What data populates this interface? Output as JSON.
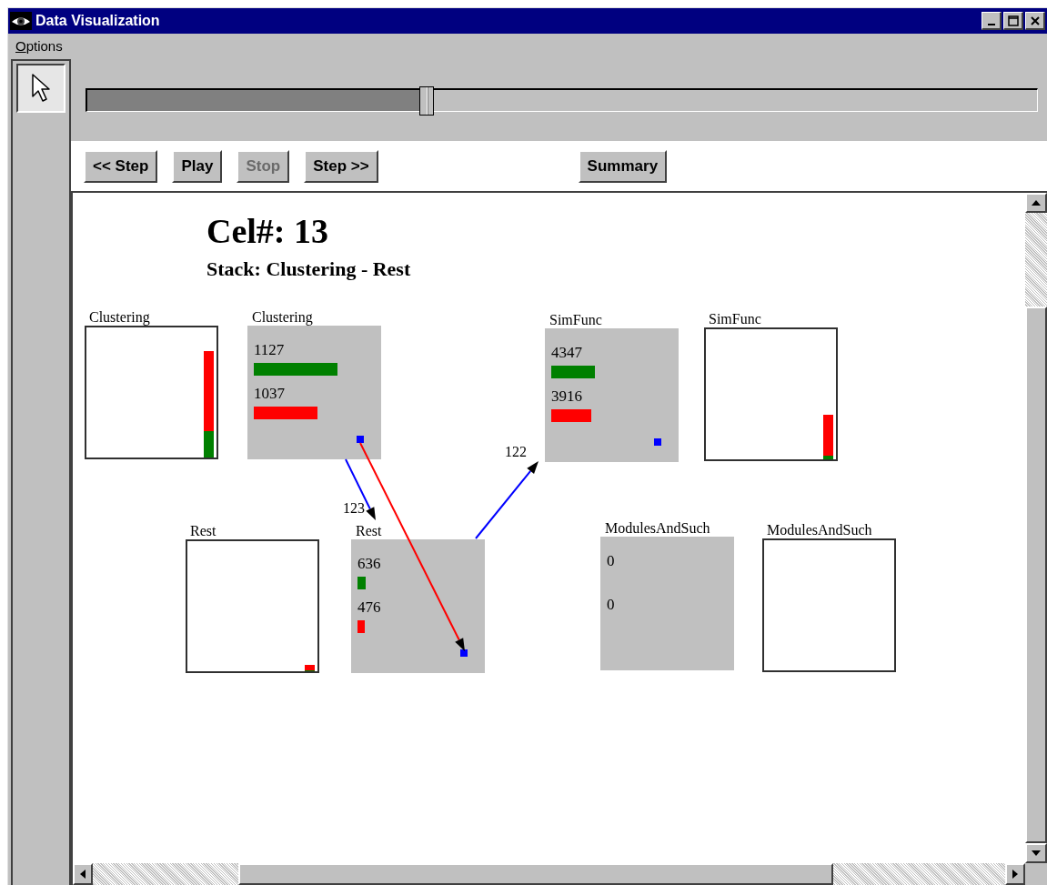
{
  "window": {
    "title": "Data Visualization"
  },
  "menu": [
    {
      "label": "Options"
    }
  ],
  "pointer_tool": {
    "selected": true
  },
  "timeline": {
    "level": 0.352
  },
  "controls": [
    {
      "label": "<< Step",
      "disabled": false
    },
    {
      "label": "Play",
      "disabled": false
    },
    {
      "label": "Stop",
      "disabled": true
    },
    {
      "label": "Step >>",
      "disabled": false
    }
  ],
  "summary_button": {
    "label": "Summary",
    "disabled": false
  },
  "canvas": {
    "cel": "Cel#: 13",
    "stack": "Stack: Clustering - Rest",
    "nodes": [
      {
        "label": "Clustering",
        "kind": "summary",
        "bars": [
          {
            "color": "#008000",
            "level": 0.2
          },
          {
            "color": "#ff0000",
            "level": 0.82
          }
        ]
      },
      {
        "label": "Clustering",
        "kind": "detail",
        "rows": [
          {
            "value": "1127",
            "color": "#008000",
            "level": 0.69
          },
          {
            "value": "1037",
            "color": "#ff0000",
            "level": 0.53
          }
        ],
        "marker": true
      },
      {
        "label": "SimFunc",
        "kind": "detail",
        "rows": [
          {
            "value": "4347",
            "color": "#008000",
            "level": 0.36
          },
          {
            "value": "3916",
            "color": "#ff0000",
            "level": 0.33
          }
        ],
        "marker": true
      },
      {
        "label": "SimFunc",
        "kind": "summary",
        "bars": [
          {
            "color": "#008000",
            "level": 0.03
          },
          {
            "color": "#ff0000",
            "level": 0.34
          }
        ]
      },
      {
        "label": "Rest",
        "kind": "summary",
        "bars": [
          {
            "color": "#008000",
            "level": 0.01
          },
          {
            "color": "#ff0000",
            "level": 0.05
          }
        ]
      },
      {
        "label": "Rest",
        "kind": "detail",
        "rows": [
          {
            "value": "636",
            "color": "#008000",
            "level": 0.07
          },
          {
            "value": "476",
            "color": "#ff0000",
            "level": 0.06
          }
        ],
        "marker": true
      },
      {
        "label": "ModulesAndSuch",
        "kind": "detail",
        "rows": [
          {
            "value": "0"
          },
          {
            "value": "0"
          }
        ],
        "marker": false
      },
      {
        "label": "ModulesAndSuch",
        "kind": "summary"
      }
    ],
    "edges": [
      {
        "color": "#0000ff",
        "label": "123"
      },
      {
        "color": "#ff0000"
      },
      {
        "color": "#0000ff",
        "label": "122"
      }
    ]
  }
}
